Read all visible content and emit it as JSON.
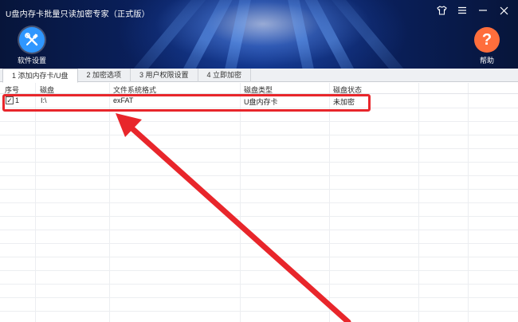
{
  "window": {
    "title": "U盘内存卡批量只读加密专家（正式版）",
    "controls": [
      "skin-icon",
      "menu-icon",
      "minimize-icon",
      "close-icon"
    ]
  },
  "toolbar": {
    "settings_label": "软件设置",
    "help_label": "帮助",
    "help_glyph": "?"
  },
  "tabs": [
    {
      "label": "1 添加内存卡/U盘",
      "active": true
    },
    {
      "label": "2 加密选项",
      "active": false
    },
    {
      "label": "3 用户权限设置",
      "active": false
    },
    {
      "label": "4 立即加密",
      "active": false
    }
  ],
  "table": {
    "headers": [
      "序号",
      "磁盘",
      "文件系统格式",
      "磁盘类型",
      "磁盘状态"
    ],
    "rows": [
      {
        "checked": true,
        "index": "1",
        "disk": "I:\\",
        "fs": "exFAT",
        "type": "U盘内存卡",
        "status": "未加密"
      }
    ]
  },
  "colors": {
    "highlight": "#e8262b",
    "header_bg": "#0b2a78",
    "settings_icon": "#2f97ff",
    "help_icon": "#ff6e3c"
  }
}
